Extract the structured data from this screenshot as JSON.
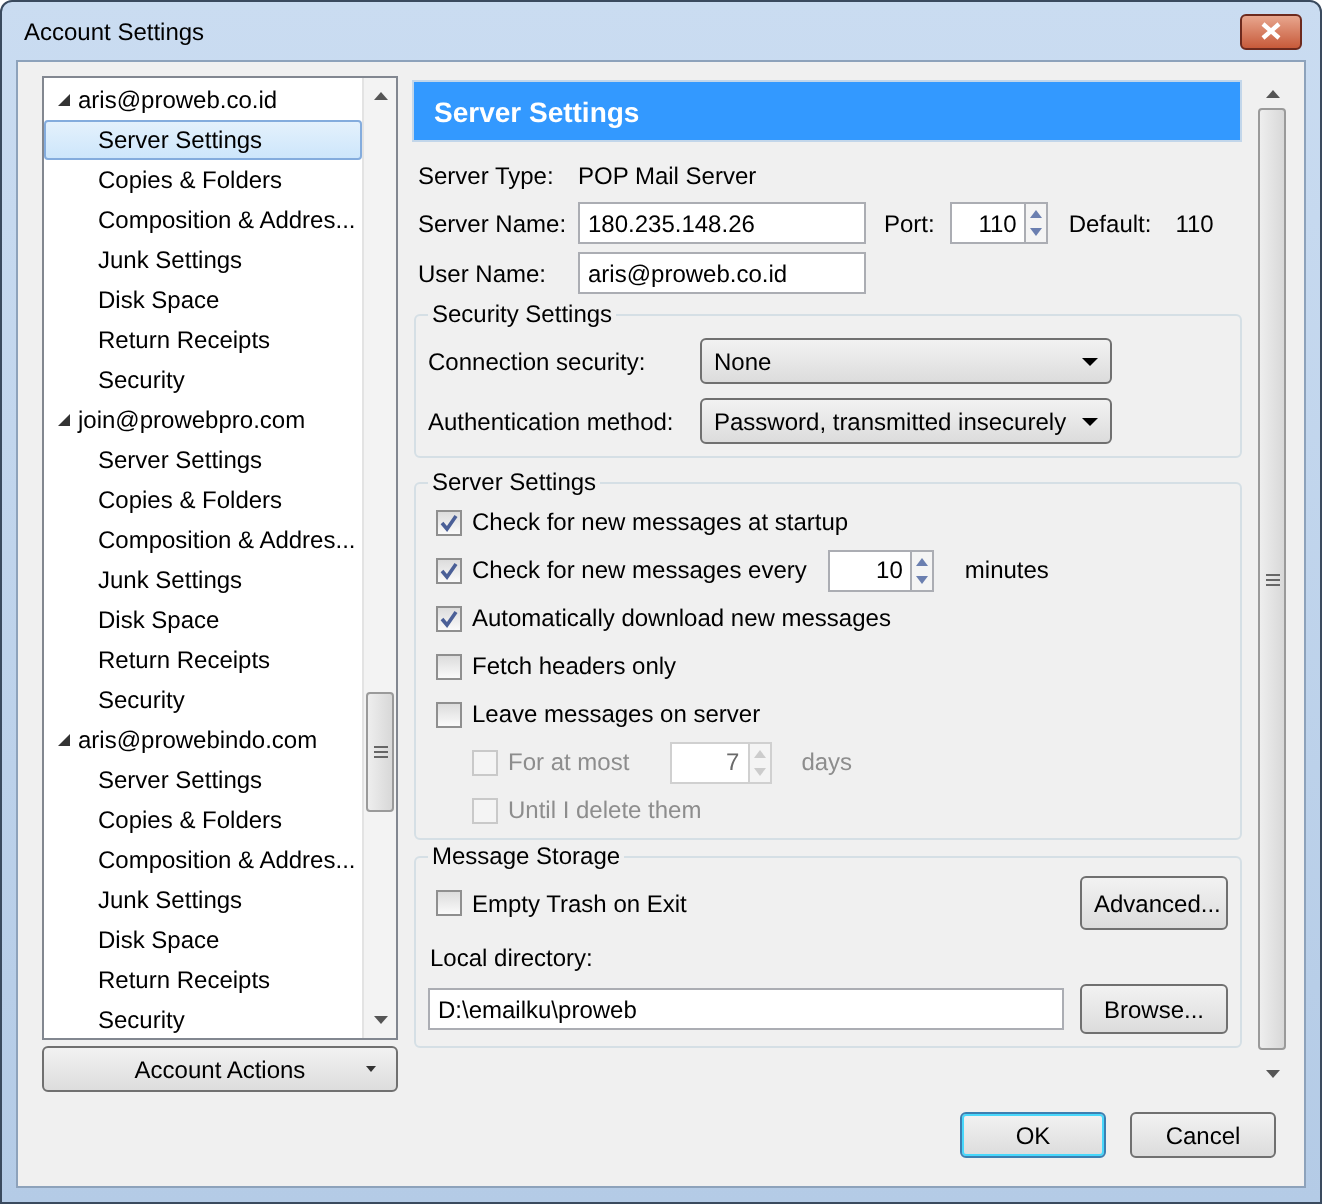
{
  "window": {
    "title": "Account Settings"
  },
  "accounts": [
    {
      "email": "aris@proweb.co.id",
      "expanded": true,
      "children": [
        {
          "label": "Server Settings",
          "selected": true
        },
        {
          "label": "Copies & Folders",
          "selected": false
        },
        {
          "label": "Composition & Addres...",
          "selected": false
        },
        {
          "label": "Junk Settings",
          "selected": false
        },
        {
          "label": "Disk Space",
          "selected": false
        },
        {
          "label": "Return Receipts",
          "selected": false
        },
        {
          "label": "Security",
          "selected": false
        }
      ]
    },
    {
      "email": "join@prowebpro.com",
      "expanded": true,
      "children": [
        {
          "label": "Server Settings",
          "selected": false
        },
        {
          "label": "Copies & Folders",
          "selected": false
        },
        {
          "label": "Composition & Addres...",
          "selected": false
        },
        {
          "label": "Junk Settings",
          "selected": false
        },
        {
          "label": "Disk Space",
          "selected": false
        },
        {
          "label": "Return Receipts",
          "selected": false
        },
        {
          "label": "Security",
          "selected": false
        }
      ]
    },
    {
      "email": "aris@prowebindo.com",
      "expanded": true,
      "children": [
        {
          "label": "Server Settings",
          "selected": false
        },
        {
          "label": "Copies & Folders",
          "selected": false
        },
        {
          "label": "Composition & Addres...",
          "selected": false
        },
        {
          "label": "Junk Settings",
          "selected": false
        },
        {
          "label": "Disk Space",
          "selected": false
        },
        {
          "label": "Return Receipts",
          "selected": false
        },
        {
          "label": "Security",
          "selected": false
        }
      ]
    }
  ],
  "account_actions_button": "Account Actions",
  "panel": {
    "title": "Server Settings",
    "server_type": {
      "label": "Server Type:",
      "value": "POP Mail Server"
    },
    "server_name": {
      "label": "Server Name:",
      "value": "180.235.148.26"
    },
    "port": {
      "label": "Port:",
      "value": "110"
    },
    "default_port": {
      "label": "Default:",
      "value": "110"
    },
    "user_name": {
      "label": "User Name:",
      "value": "aris@proweb.co.id"
    },
    "security_settings": {
      "legend": "Security Settings",
      "rows": [
        {
          "label": "Connection security:",
          "value": "None"
        },
        {
          "label": "Authentication method:",
          "value": "Password, transmitted insecurely"
        }
      ]
    },
    "server_settings": {
      "legend": "Server Settings",
      "options": [
        {
          "kind": "checkbox",
          "label": "Check for new messages at startup",
          "checked": true,
          "disabled": false
        },
        {
          "kind": "checkbox_number",
          "label": "Check for new messages every",
          "checked": true,
          "disabled": false,
          "value": "10",
          "unit": "minutes"
        },
        {
          "kind": "checkbox",
          "label": "Automatically download new messages",
          "checked": true,
          "disabled": false
        },
        {
          "kind": "checkbox",
          "label": "Fetch headers only",
          "checked": false,
          "disabled": false
        },
        {
          "kind": "checkbox",
          "label": "Leave messages on server",
          "checked": false,
          "disabled": false,
          "children": [
            {
              "kind": "checkbox_number",
              "label": "For at most",
              "checked": false,
              "disabled": true,
              "value": "7",
              "unit": "days"
            },
            {
              "kind": "checkbox",
              "label": "Until I delete them",
              "checked": false,
              "disabled": true
            }
          ]
        }
      ]
    },
    "message_storage": {
      "legend": "Message Storage",
      "empty_trash": {
        "label": "Empty Trash on Exit",
        "checked": false
      },
      "advanced_button": "Advanced...",
      "local_directory_label": "Local directory:",
      "local_directory": "D:\\emailku\\proweb",
      "browse_button": "Browse..."
    }
  },
  "buttons": [
    {
      "label": "OK",
      "default": true
    },
    {
      "label": "Cancel",
      "default": false
    }
  ]
}
